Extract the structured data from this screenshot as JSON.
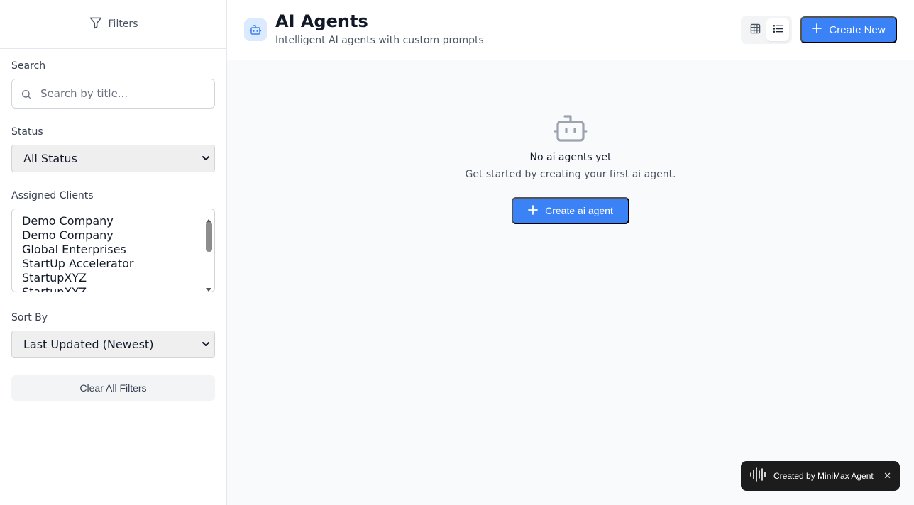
{
  "sidebar": {
    "header_label": "Filters",
    "search": {
      "label": "Search",
      "placeholder": "Search by title..."
    },
    "status": {
      "label": "Status",
      "selected": "All Status"
    },
    "clients": {
      "label": "Assigned Clients",
      "options": [
        "Demo Company",
        "Demo Company",
        "Global Enterprises",
        "StartUp Accelerator",
        "StartupXYZ",
        "StartupXYZ"
      ]
    },
    "sort": {
      "label": "Sort By",
      "selected": "Last Updated (Newest)"
    },
    "clear_label": "Clear All Filters"
  },
  "header": {
    "title": "AI Agents",
    "subtitle": "Intelligent AI agents with custom prompts",
    "create_label": "Create New",
    "view_modes": [
      "grid-view",
      "list-view"
    ],
    "active_view": "list-view"
  },
  "empty_state": {
    "title": "No ai agents yet",
    "description": "Get started by creating your first ai agent.",
    "cta_label": "Create ai agent"
  },
  "badge": {
    "text": "Created by MiniMax Agent",
    "close": "✕"
  },
  "colors": {
    "accent": "#3b82f6",
    "sidebar_bg": "#ffffff",
    "page_bg": "#f9fafb",
    "badge_bg": "#1c1c1c"
  }
}
